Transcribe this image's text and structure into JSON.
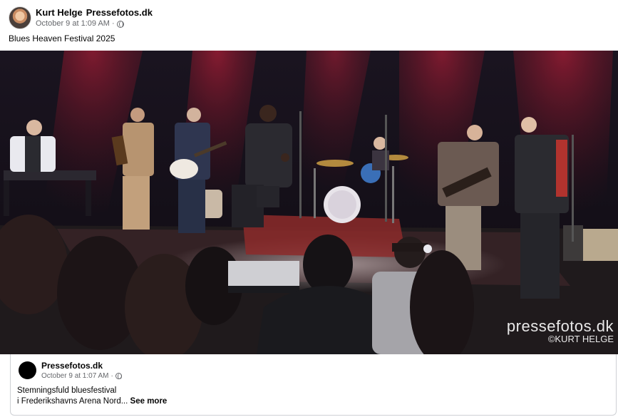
{
  "post": {
    "author": "Kurt Helge",
    "page": "Pressefotos.dk",
    "timestamp": "October 9 at 1:09 AM",
    "separator": "·",
    "privacy_icon": "globe-icon",
    "text": "Blues Heaven Festival 2025"
  },
  "photo": {
    "watermark_main": "pressefotos.dk",
    "watermark_sub": "©KURT HELGE"
  },
  "shared": {
    "name": "Pressefotos.dk",
    "timestamp": "October 9 at 1:07 AM",
    "separator": "·",
    "privacy_icon": "globe-icon",
    "line1": "Stemningsfuld bluesfestival",
    "line2": "i Frederikshavns Arena Nord...",
    "see_more": "See more"
  },
  "colors": {
    "link_grey": "#65676b",
    "stage_red": "#9b1a2a",
    "card_border": "#ced0d4"
  }
}
